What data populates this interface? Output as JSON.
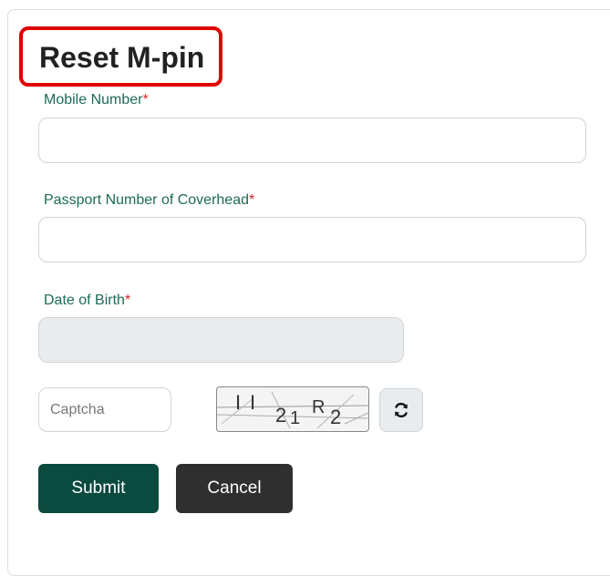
{
  "form": {
    "title": "Reset M-pin",
    "required_marker": "*",
    "mobile_label": "Mobile Number",
    "mobile_value": "",
    "passport_label": "Passport Number of Coverhead",
    "passport_value": "",
    "dob_label": "Date of Birth",
    "dob_value": "",
    "captcha_placeholder": "Captcha",
    "captcha_text": "II 2 1 R 2",
    "submit_label": "Submit",
    "cancel_label": "Cancel"
  },
  "colors": {
    "label": "#1d6b57",
    "required": "#d62828",
    "highlight": "#e00000",
    "submit_bg": "#0b4a3f",
    "cancel_bg": "#2f2f2f"
  },
  "icons": {
    "refresh": "refresh-icon"
  }
}
